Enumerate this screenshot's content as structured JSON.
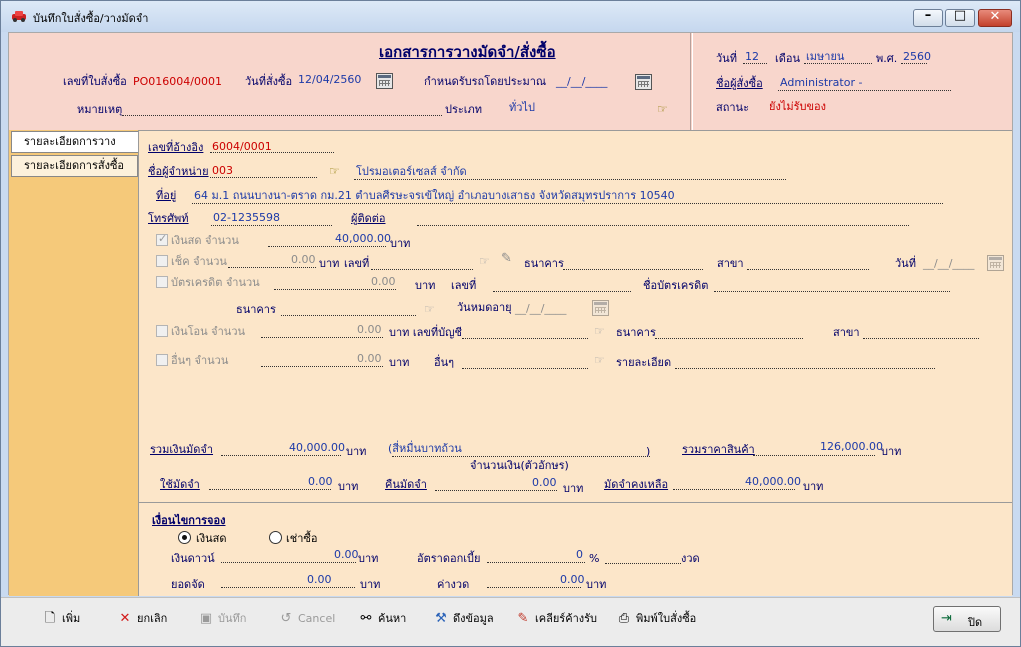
{
  "window": {
    "title": "บันทึกใบสั่งซื้อ/วางมัดจำ",
    "icon": "car-icon"
  },
  "header": {
    "title": "เอกสารการวางมัดจำ/สั่งซื้อ",
    "po_label": "เลขที่ใบสั่งซื้อ",
    "po_value": "PO016004/0001",
    "order_date_label": "วันที่สั่งซื้อ",
    "order_date_value": "12/04/2560",
    "pickup_label": "กำหนดรับรถโดยประมาณ",
    "pickup_value": "__/__/____",
    "note_label": "หมายเหตุ",
    "type_label": "ประเภท",
    "type_value": "ทั่วไป",
    "day_label": "วันที่",
    "day_value": "12",
    "month_label": "เดือน",
    "month_value": "เมษายน",
    "year_label": "พ.ศ.",
    "year_value": "2560",
    "buyer_label": "ชื่อผู้สั่งซื้อ",
    "buyer_value": "Administrator -",
    "status_label": "สถานะ",
    "status_value": "ยังไม่รับของ"
  },
  "tabs": [
    {
      "label": "รายละเอียดการวางมัดจำ"
    },
    {
      "label": "รายละเอียดการสั่งซื้อ"
    }
  ],
  "form": {
    "ref_label": "เลขที่อ้างอิง",
    "ref_value": "6004/0001",
    "vendor_label": "ชื่อผู้จำหน่าย",
    "vendor_code": "003",
    "vendor_name": "โปรมอเตอร์เซลส์ จำกัด",
    "address_label": "ที่อยู่",
    "address_value": "64 ม.1 ถนนบางนา-ตราด กม.21 ตำบลศีรษะจรเข้ใหญ่ อำเภอบางเสาธง จังหวัดสมุทรปราการ 10540",
    "phone_label": "โทรศัพท์",
    "phone_value": "02-1235598",
    "contact_label": "ผู้ติดต่อ",
    "cash_label": "เงินสด จำนวน",
    "cash_value": "40,000.00",
    "baht": "บาท",
    "cheque_label": "เช็ค จำนวน",
    "cheque_value": "0.00",
    "cheque_no_label": "เลขที่",
    "bank_label": "ธนาคาร",
    "branch_label": "สาขา",
    "date_label": "วันที่",
    "date_value": "__/__/____",
    "credit_label": "บัตรเครดิต จำนวน",
    "credit_value": "0.00",
    "credit_no_label": "เลขที่",
    "card_name_label": "ชื่อบัตรเครดิต",
    "credit_bank_label": "ธนาคาร",
    "expiry_label": "วันหมดอายุ",
    "expiry_value": "__/__/____",
    "transfer_label": "เงินโอน จำนวน",
    "transfer_value": "0.00",
    "account_label": "บาท เลขที่บัญชี",
    "transfer_bank_label": "ธนาคาร",
    "transfer_branch_label": "สาขา",
    "other_label": "อื่นๆ จำนวน",
    "other_value": "0.00",
    "other_name_label": "อื่นๆ",
    "detail_label": "รายละเอียด",
    "total_deposit_label": "รวมเงินมัดจำ",
    "total_deposit_value": "40,000.00",
    "words_value": "(สี่หมื่นบาทถ้วน",
    "words_close": ")",
    "words_caption": "จำนวนเงิน(ตัวอักษร)",
    "total_price_label": "รวมราคาสินค้า",
    "total_price_value": "126,000.00",
    "used_label": "ใช้มัดจำ",
    "used_value": "0.00",
    "refund_label": "คืนมัดจำ",
    "refund_value": "0.00",
    "remain_label": "มัดจำคงเหลือ",
    "remain_value": "40,000.00"
  },
  "booking": {
    "title": "เงื่อนไขการจอง",
    "cash_option": "เงินสด",
    "lease_option": "เช่าซื้อ",
    "down_label": "เงินดาวน์",
    "down_value": "0.00",
    "rate_label": "อัตราดอกเบี้ย",
    "rate_value": "0",
    "percent": "%",
    "installment_unit": "งวด",
    "finance_label": "ยอดจัด",
    "finance_value": "0.00",
    "monthly_label": "ค่างวด",
    "monthly_value": "0.00"
  },
  "toolbar": {
    "add": "เพิ่ม",
    "cancel_edit": "ยกเลิก",
    "save": "บันทึก",
    "cancel": "Cancel",
    "search": "ค้นหา",
    "fetch": "ดึงข้อมูล",
    "clear": "เคลียร์ค้างรับ",
    "print": "พิมพ์ใบสั่งซื้อ",
    "close": "ปิด"
  },
  "colors": {
    "header_bg": "#f8d6cc",
    "form_bg": "#fce6c9",
    "tab_strip": "#f5c97a",
    "value_red": "#cc0000",
    "value_blue": "#1d3aa8"
  }
}
